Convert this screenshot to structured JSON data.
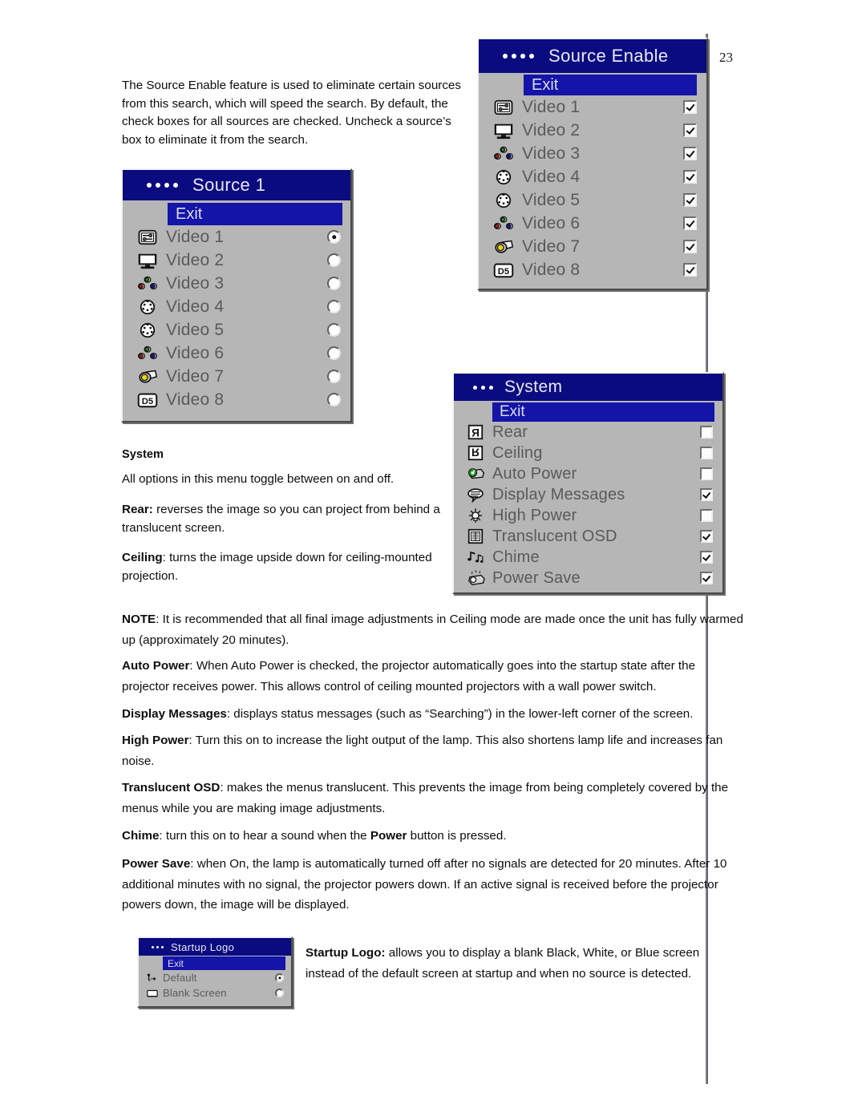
{
  "page": {
    "number": "23"
  },
  "intro": {
    "paragraph": "The Source Enable feature is used to eliminate certain sources from this search, which will speed the search. By default, the check boxes for all sources are checked. Uncheck a source’s box to eliminate it from the search."
  },
  "system_section": {
    "heading": "System",
    "intro": "All options in this menu toggle between on and off.",
    "rear_term": "Rear:",
    "rear_text": " reverses the image so you can project from behind a translucent screen.",
    "ceiling_term": "Ceiling",
    "ceiling_text": ": turns the image upside down for ceiling-mounted projection."
  },
  "notes": [
    {
      "term": "NOTE",
      "text": ": It is recommended that all final image adjustments in Ceiling mode are made once the unit has fully warmed up (approximately 20 minutes)."
    },
    {
      "term": "Auto Power",
      "text": ": When Auto Power is checked, the projector automatically goes into the startup state after the projector receives power. This allows control of ceiling mounted projectors with a wall power switch."
    },
    {
      "term": "Display Messages",
      "text": ": displays status messages (such as “Searching”) in the lower-left corner of the screen."
    },
    {
      "term": "High Power",
      "text": ": Turn this on to increase the light output of the lamp. This also shortens lamp life and increases fan noise."
    },
    {
      "term": "Translucent OSD",
      "text": ": makes the menus translucent. This prevents the image from being completely covered by the menus while you are making image adjustments."
    }
  ],
  "chime": {
    "term": "Chime",
    "text_before": ": turn this on to hear a sound when the ",
    "bold_mid": "Power",
    "text_after": " button is pressed."
  },
  "power_save": {
    "term": "Power Save",
    "text": ": when On, the lamp is automatically turned off after no signals are detected for 20 minutes. After 10 additional minutes with no signal, the projector powers down. If an active signal is received before the projector powers down, the image will be displayed."
  },
  "startup_logo_caption": {
    "term": "Startup Logo:",
    "text": " allows you to display a blank Black, White, or Blue screen instead of the default screen at startup and when no source is detected."
  },
  "colors": {
    "title_bar": "#0b0b80",
    "highlight_bar": "#1414a8",
    "menu_face": "#b6b6b6",
    "menu_text": "#5a5a5a",
    "title_text": "#e8e8f2"
  },
  "menus": {
    "source1": {
      "title": "Source 1",
      "dots": 4,
      "exit": "Exit",
      "control_type": "radio",
      "rows": [
        {
          "label": "Video 1",
          "icon": "computer-in-switch-icon",
          "selected": true
        },
        {
          "label": "Video 2",
          "icon": "monitor-icon",
          "selected": false
        },
        {
          "label": "Video 3",
          "icon": "rgb-component-jacks-icon",
          "selected": false
        },
        {
          "label": "Video 4",
          "icon": "s-video-din-icon",
          "selected": false
        },
        {
          "label": "Video 5",
          "icon": "s-video-din-icon",
          "selected": false
        },
        {
          "label": "Video 6",
          "icon": "rgb-component-jacks-icon",
          "selected": false
        },
        {
          "label": "Video 7",
          "icon": "composite-rca-jack-icon",
          "selected": false
        },
        {
          "label": "Video 8",
          "icon": "d5-connector-icon",
          "selected": false
        }
      ]
    },
    "source_enable": {
      "title": "Source Enable",
      "dots": 4,
      "exit": "Exit",
      "control_type": "checkbox",
      "rows": [
        {
          "label": "Video 1",
          "icon": "computer-in-switch-icon",
          "checked": true
        },
        {
          "label": "Video 2",
          "icon": "monitor-icon",
          "checked": true
        },
        {
          "label": "Video 3",
          "icon": "rgb-component-jacks-icon",
          "checked": true
        },
        {
          "label": "Video 4",
          "icon": "s-video-din-icon",
          "checked": true
        },
        {
          "label": "Video 5",
          "icon": "s-video-din-icon",
          "checked": true
        },
        {
          "label": "Video 6",
          "icon": "rgb-component-jacks-icon",
          "checked": true
        },
        {
          "label": "Video 7",
          "icon": "composite-rca-jack-icon",
          "checked": true
        },
        {
          "label": "Video 8",
          "icon": "d5-connector-icon",
          "checked": true
        }
      ]
    },
    "system": {
      "title": "System",
      "dots": 3,
      "exit": "Exit",
      "control_type": "checkbox",
      "rows": [
        {
          "label": "Rear",
          "icon": "mirrored-r-icon",
          "checked": false
        },
        {
          "label": "Ceiling",
          "icon": "flipped-r-icon",
          "checked": false
        },
        {
          "label": "Auto Power",
          "icon": "auto-power-projector-icon",
          "checked": false
        },
        {
          "label": "Display Messages",
          "icon": "speech-balloon-icon",
          "checked": true
        },
        {
          "label": "High Power",
          "icon": "lamp-bulb-icon",
          "checked": false
        },
        {
          "label": "Translucent OSD",
          "icon": "translucent-menu-icon",
          "checked": true
        },
        {
          "label": "Chime",
          "icon": "music-notes-icon",
          "checked": true
        },
        {
          "label": "Power Save",
          "icon": "sleeping-projector-icon",
          "checked": true
        }
      ]
    },
    "startup_logo": {
      "title": "Startup Logo",
      "dots": 3,
      "exit": "Exit",
      "control_type": "radio",
      "rows": [
        {
          "label": "Default",
          "icon": "default-logo-icon",
          "selected": true
        },
        {
          "label": "Blank Screen",
          "icon": "blank-screen-icon",
          "selected": false
        }
      ]
    }
  }
}
